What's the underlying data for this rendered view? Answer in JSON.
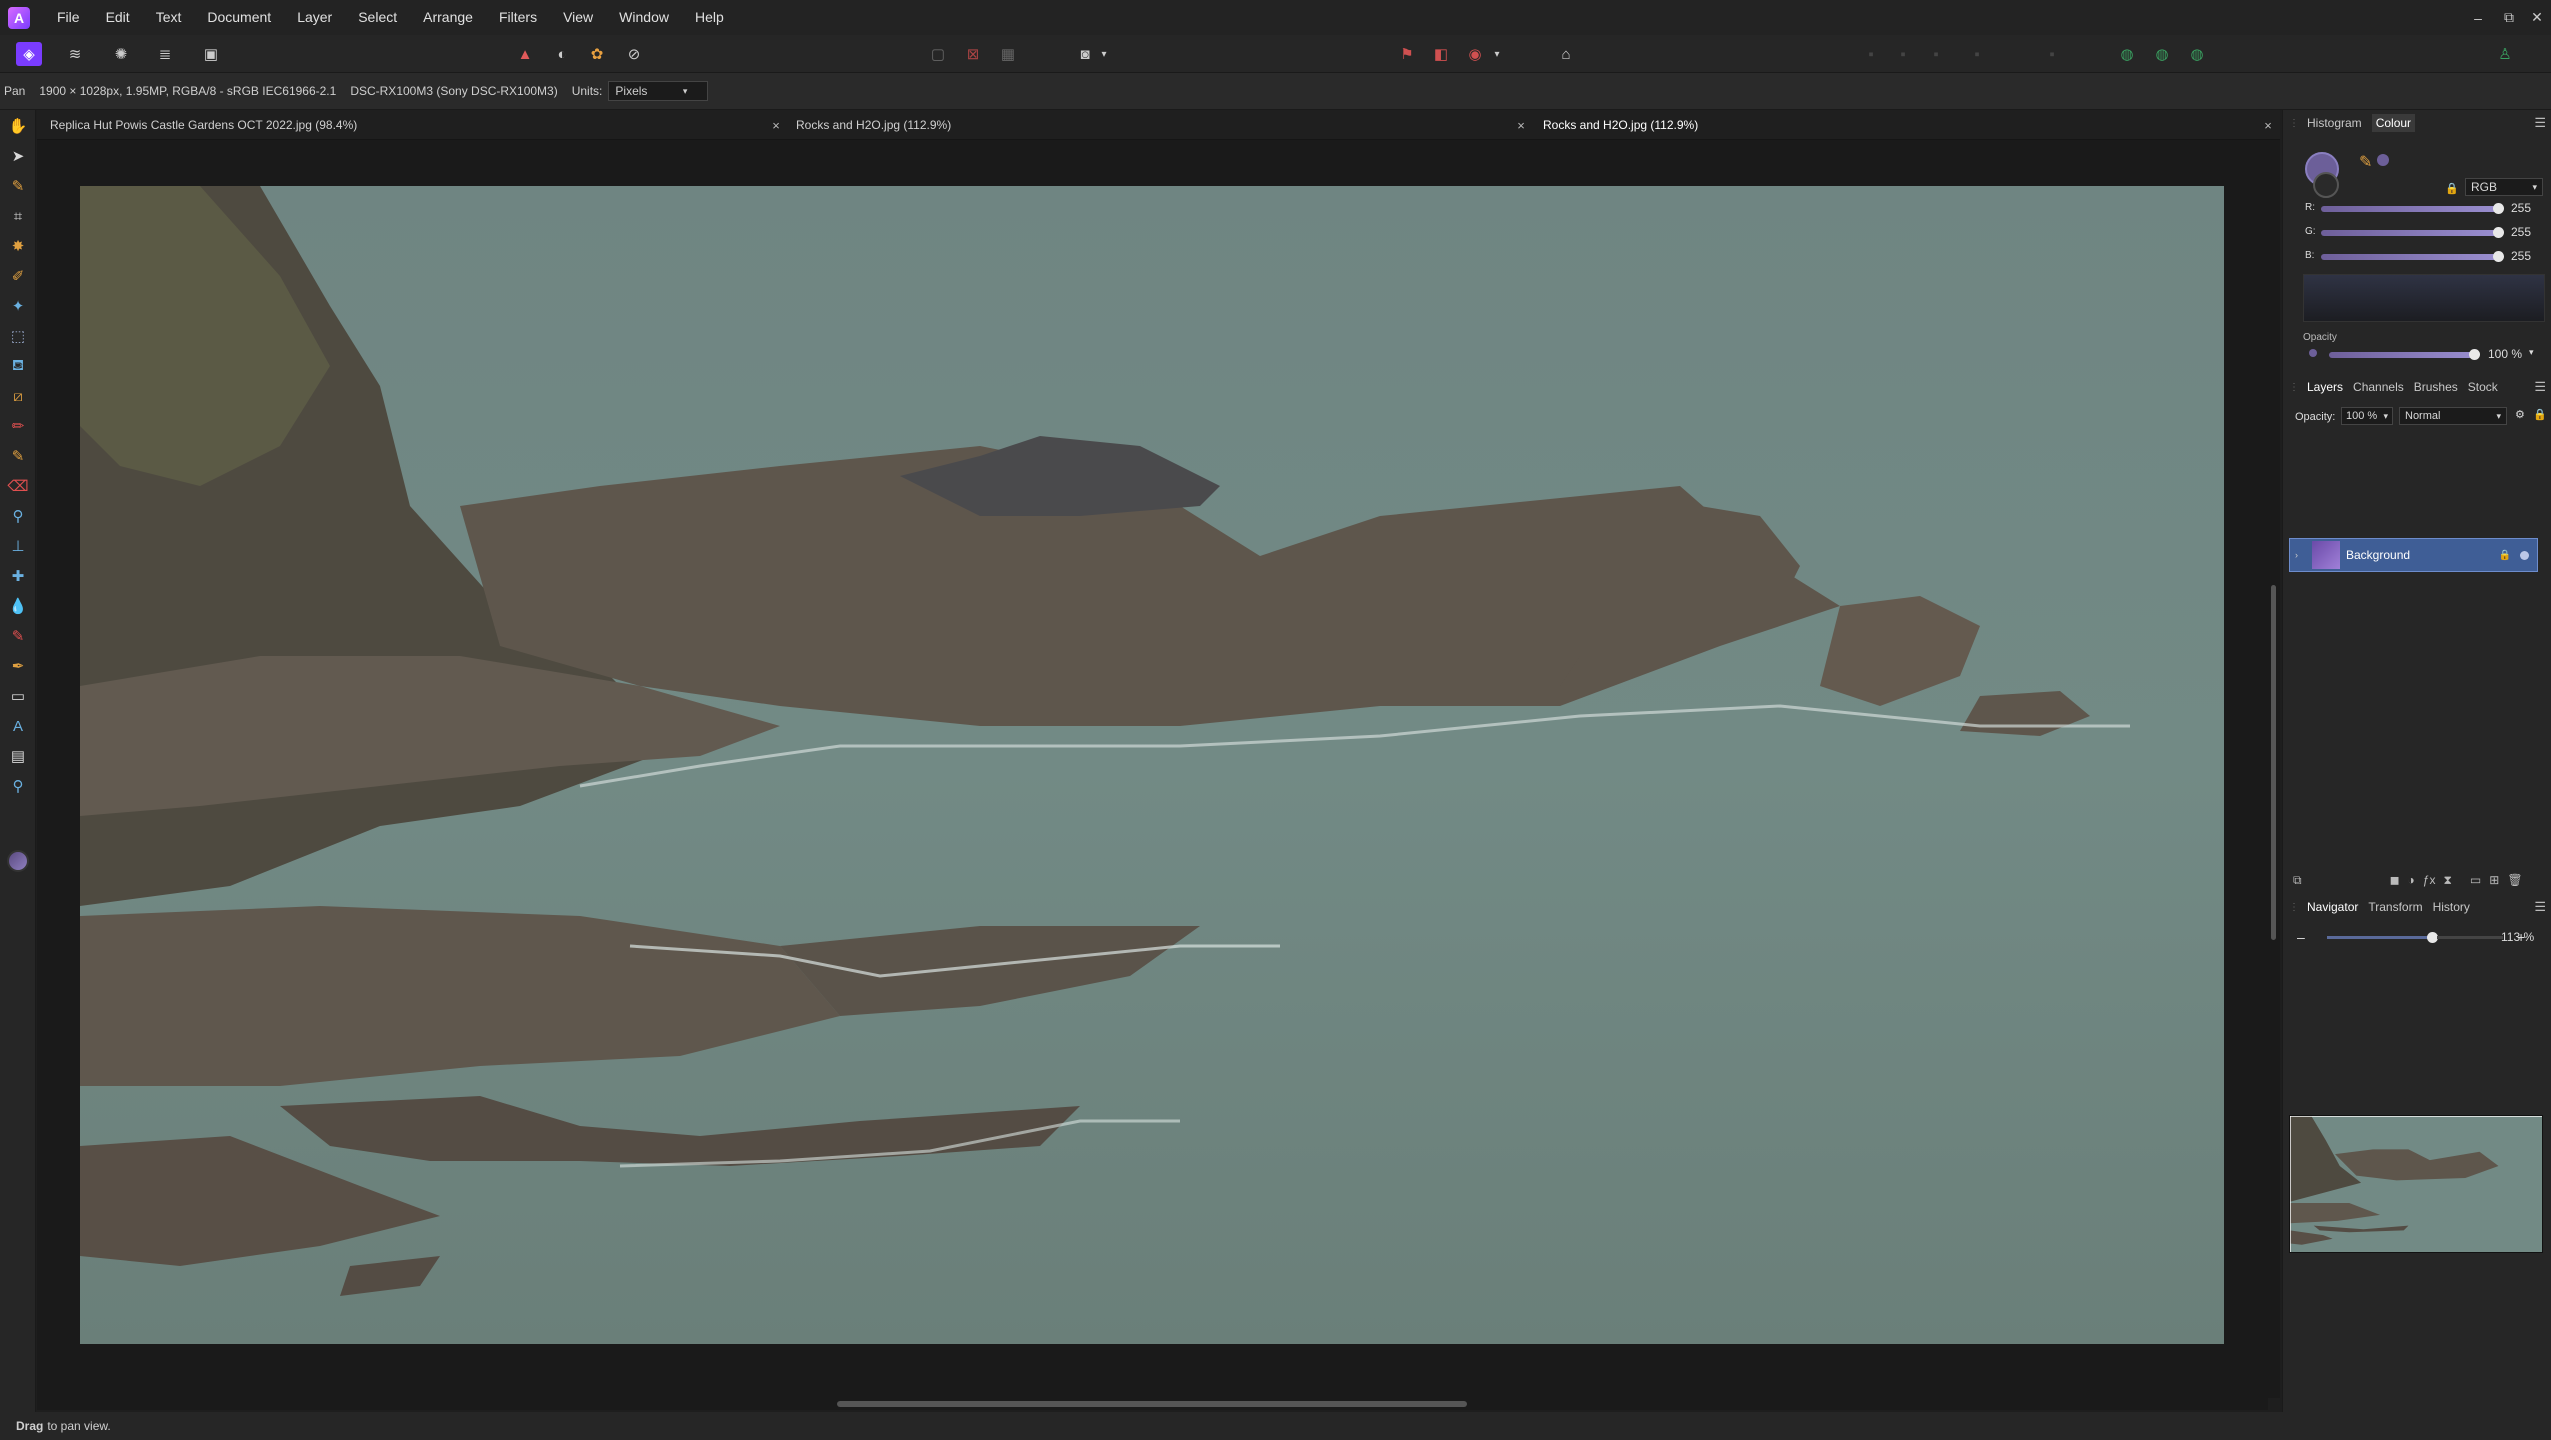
{
  "app": {
    "accent": "#7a3cff"
  },
  "menu": [
    "File",
    "Edit",
    "Text",
    "Document",
    "Layer",
    "Select",
    "Arrange",
    "Filters",
    "View",
    "Window",
    "Help"
  ],
  "window_controls": {
    "minimize": "–",
    "restore": "⧉",
    "close": "✕"
  },
  "context": {
    "tool": "Pan",
    "doc_info": "1900 × 1028px, 1.95MP, RGBA/8 - sRGB IEC61966-2.1",
    "camera": "DSC-RX100M3 (Sony DSC-RX100M3)",
    "units_label": "Units:",
    "units_value": "Pixels"
  },
  "tabs": [
    {
      "label": "Replica Hut Powis Castle Gardens OCT 2022.jpg (98.4%)"
    },
    {
      "label": "Rocks and H2O.jpg (112.9%)"
    },
    {
      "label": "Rocks and H2O.jpg (112.9%)"
    }
  ],
  "tab_close": "×",
  "status": {
    "bold": "Drag",
    "text": "to pan view."
  },
  "panels": {
    "histogram_tab": "Histogram",
    "colour_tab": "Colour",
    "colour_model": "RGB",
    "r_label": "R:",
    "r_value": "255",
    "g_label": "G:",
    "g_value": "255",
    "b_label": "B:",
    "b_value": "255",
    "opacity_label": "Opacity",
    "opacity_value": "100 %",
    "layers_tabs": [
      "Layers",
      "Channels",
      "Brushes",
      "Stock"
    ],
    "layers_opacity_label": "Opacity:",
    "layers_opacity_value": "100 %",
    "blend_mode": "Normal",
    "layer_name": "Background",
    "nav_tabs": [
      "Navigator",
      "Transform",
      "History"
    ],
    "zoom_minus": "–",
    "zoom_plus": "+",
    "zoom_value": "113 %"
  },
  "colors": {
    "selection": "#3f5e96",
    "water": "#6f8580",
    "rock": "#6a5e52"
  }
}
